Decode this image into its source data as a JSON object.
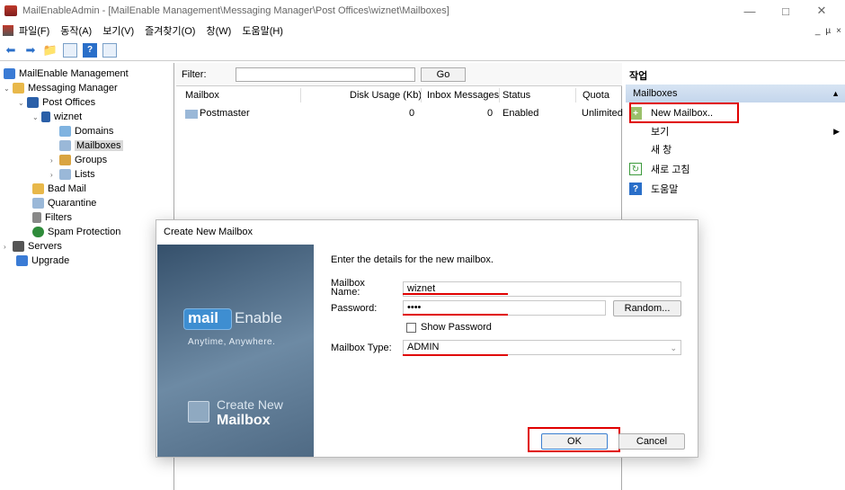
{
  "window": {
    "title": "MailEnableAdmin - [MailEnable Management\\Messaging Manager\\Post Offices\\wiznet\\Mailboxes]",
    "minimize": "—",
    "maximize": "□",
    "close": "✕"
  },
  "menu": {
    "items": [
      "파일(F)",
      "동작(A)",
      "보기(V)",
      "즐겨찾기(O)",
      "창(W)",
      "도움말(H)"
    ],
    "mdi_min": "_",
    "mdi_restore": "µ",
    "mdi_close": "×"
  },
  "tree": {
    "items": [
      {
        "label": "MailEnable Management",
        "icon": "console-icon",
        "color": "#3a7bd5"
      },
      {
        "label": "Messaging Manager",
        "icon": "folder-icon",
        "color": "#e8b84a"
      },
      {
        "label": "Post Offices",
        "icon": "building-icon",
        "color": "#2a5fa8"
      },
      {
        "label": "wiznet",
        "icon": "building-icon",
        "color": "#2a5fa8"
      },
      {
        "label": "Domains",
        "icon": "domain-icon",
        "color": "#7fb3e0"
      },
      {
        "label": "Mailboxes",
        "icon": "mailbox-icon",
        "color": "#9ab8d8"
      },
      {
        "label": "Groups",
        "icon": "users-icon",
        "color": "#d9a441"
      },
      {
        "label": "Lists",
        "icon": "list-icon",
        "color": "#9ab8d8"
      },
      {
        "label": "Bad Mail",
        "icon": "badmail-icon",
        "color": "#e8b84a"
      },
      {
        "label": "Quarantine",
        "icon": "quarantine-icon",
        "color": "#9ab8d8"
      },
      {
        "label": "Filters",
        "icon": "filter-icon",
        "color": "#888888"
      },
      {
        "label": "Spam Protection",
        "icon": "shield-icon",
        "color": "#2e8b3a"
      },
      {
        "label": "Servers",
        "icon": "server-icon",
        "color": "#555555"
      },
      {
        "label": "Upgrade",
        "icon": "upgrade-icon",
        "color": "#3a7bd5"
      }
    ]
  },
  "list": {
    "filter_label": "Filter:",
    "go_label": "Go",
    "columns": [
      "Mailbox",
      "Disk Usage (Kb)",
      "Inbox Messages",
      "Status",
      "Quota"
    ],
    "rows": [
      {
        "mailbox": "Postmaster",
        "disk": "0",
        "inbox": "0",
        "status": "Enabled",
        "quota": "Unlimited"
      }
    ]
  },
  "actions": {
    "title": "작업",
    "section": "Mailboxes",
    "items": [
      {
        "label": "New Mailbox..",
        "icon": "new-mailbox-icon"
      },
      {
        "label": "보기",
        "icon": ""
      },
      {
        "label": "새 창",
        "icon": ""
      },
      {
        "label": "새로 고침",
        "icon": "refresh-icon"
      },
      {
        "label": "도움말",
        "icon": "help-icon"
      }
    ]
  },
  "dialog": {
    "title": "Create New Mailbox",
    "logo_mail": "mail",
    "logo_enable": "Enable",
    "tagline": "Anytime, Anywhere.",
    "side_line1": "Create New",
    "side_line2": "Mailbox",
    "intro": "Enter the details for the new mailbox.",
    "mailbox_name_label_1": "Mailbox",
    "mailbox_name_label_2": "Name:",
    "mailbox_name_value": "wiznet",
    "password_label": "Password:",
    "password_value": "••••",
    "random_label": "Random...",
    "show_password_label": "Show Password",
    "mailbox_type_label": "Mailbox Type:",
    "mailbox_type_value": "ADMIN",
    "ok_label": "OK",
    "cancel_label": "Cancel"
  },
  "colors": {
    "annotation_red": "#e00000",
    "section_blue": "#c4d6ec",
    "side_panel": "#4f6a84"
  }
}
